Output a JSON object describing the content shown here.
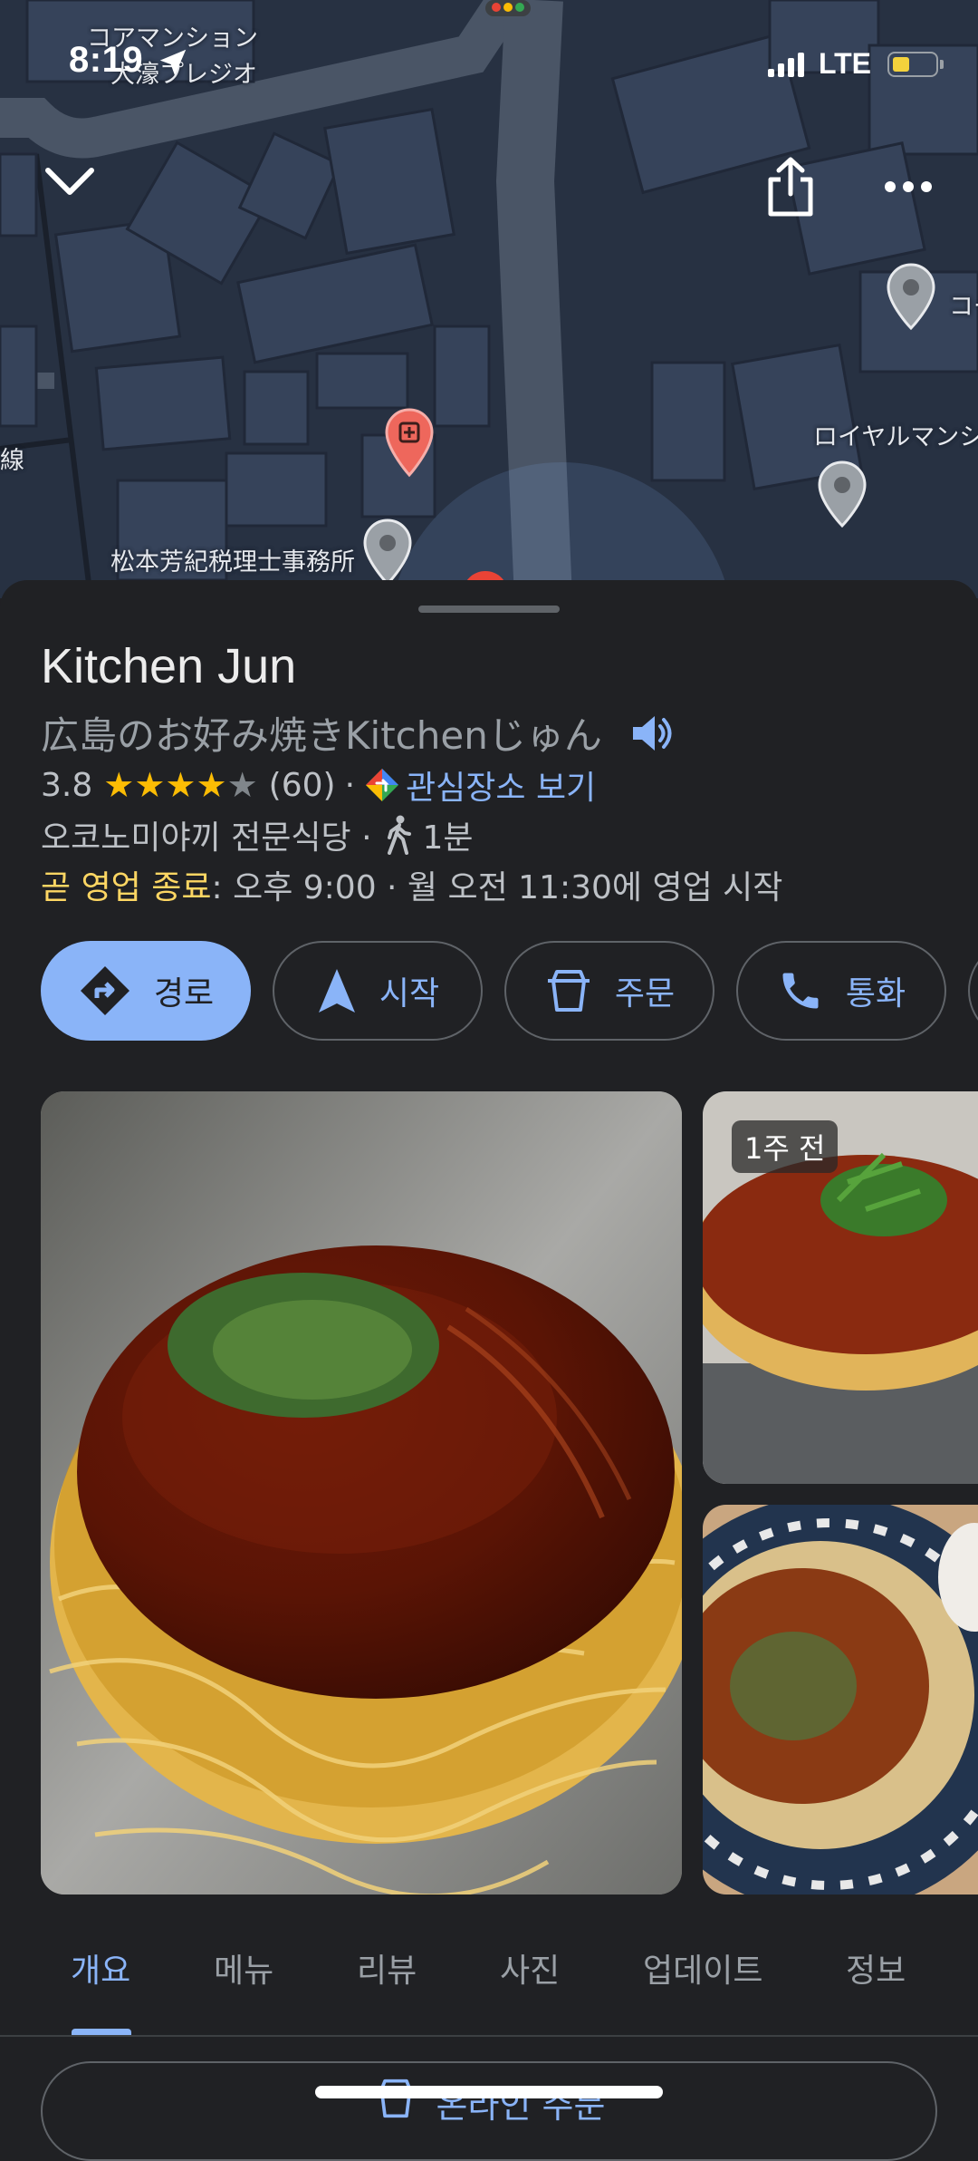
{
  "status_bar": {
    "time": "8:19",
    "network": "LTE"
  },
  "map": {
    "labels": {
      "top_line1": "コアマンション",
      "top_line2": "大濠プレジオ",
      "right_edge": "コー",
      "royal": "ロイヤルマンシ",
      "left_edge": "線",
      "tax_office": "松本芳紀税理士事務所"
    }
  },
  "top_buttons": {
    "collapse": "chevron-down-icon",
    "share": "share-icon",
    "more": "more-icon"
  },
  "place": {
    "name": "Kitchen Jun",
    "native_name": "広島のお好み焼きKitchenじゅん",
    "rating": "3.8",
    "rating_value": 3.8,
    "review_count": "(60)",
    "separator": "·",
    "interest_link": "관심장소 보기",
    "category": "오코노미야끼 전문식당 ·",
    "walk_time": "1분",
    "status_label": "곧 영업 종료",
    "hours_detail": ": 오후 9:00 · 월 오전 11:30에 영업 시작"
  },
  "actions": [
    {
      "label": "경로",
      "icon": "directions-icon"
    },
    {
      "label": "시작",
      "icon": "navigation-icon"
    },
    {
      "label": "주문",
      "icon": "takeout-icon"
    },
    {
      "label": "통화",
      "icon": "phone-icon"
    }
  ],
  "photos": {
    "recent_badge": "1주 전"
  },
  "tabs": [
    "개요",
    "메뉴",
    "리뷰",
    "사진",
    "업데이트",
    "정보"
  ],
  "order_button": {
    "label": "온라인 주문"
  },
  "colors": {
    "accent": "#8ab4f8",
    "star": "#fbbc04",
    "closing": "#fdd663",
    "background": "#202124",
    "map_bg": "#273142"
  }
}
